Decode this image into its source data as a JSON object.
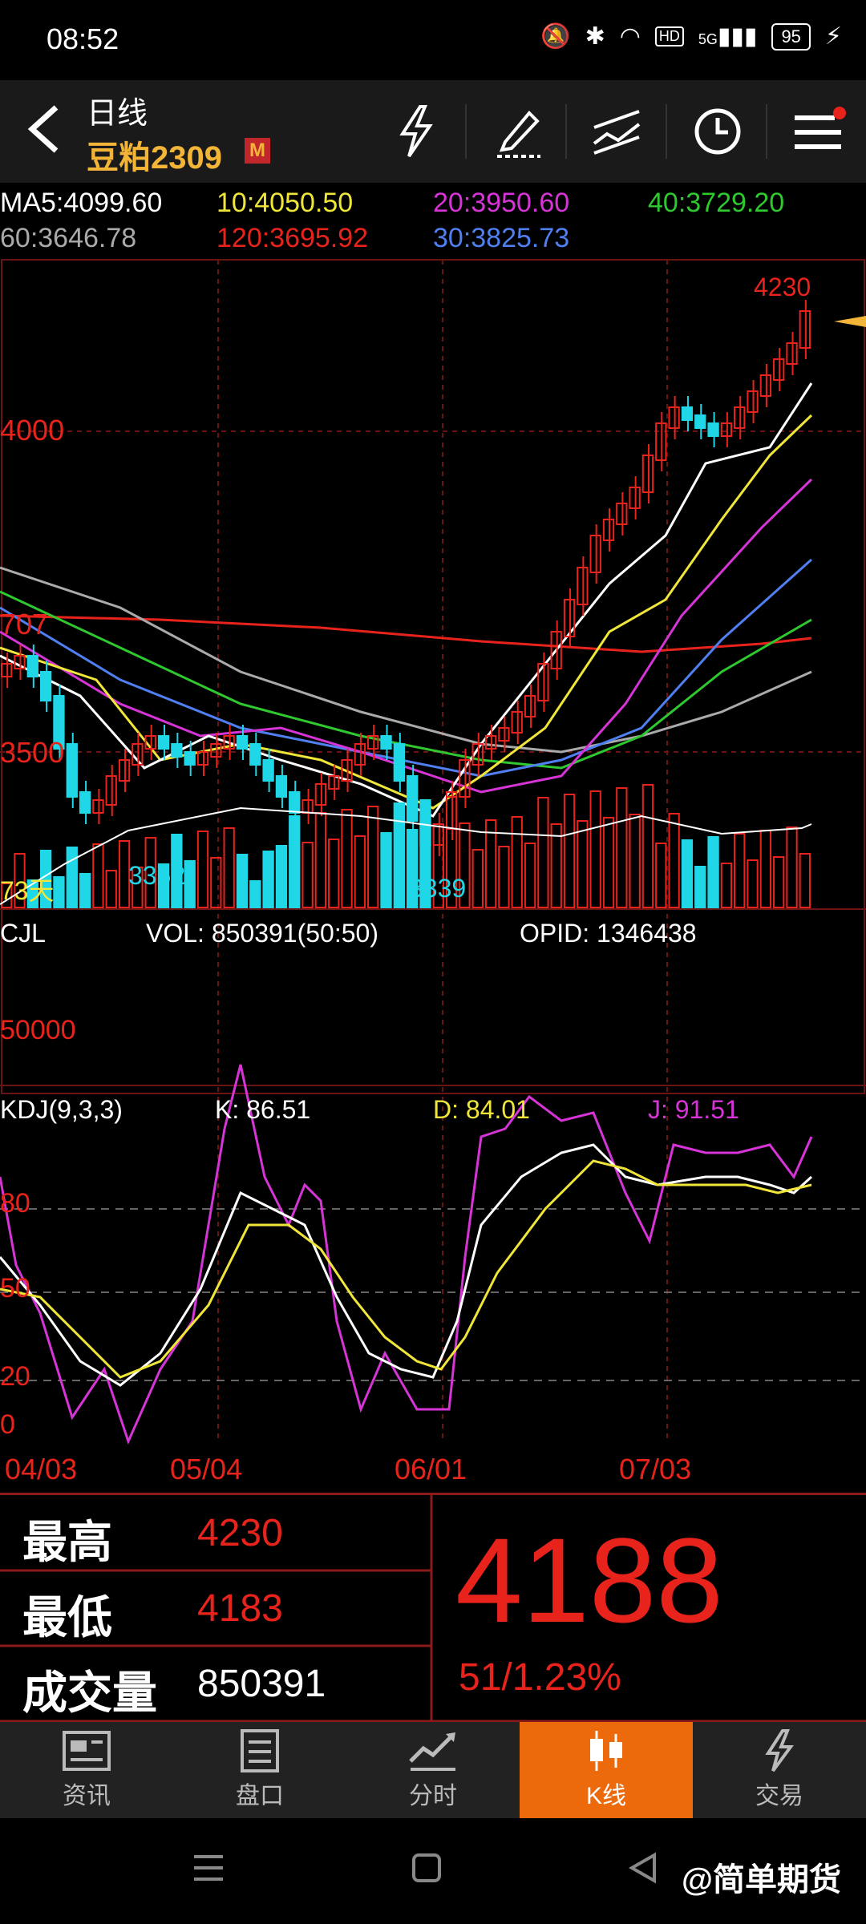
{
  "status": {
    "time": "08:52",
    "battery": "95",
    "net": "5G",
    "hd": "HD"
  },
  "header": {
    "title": "日线",
    "contract": "豆粕2309",
    "badge": "M"
  },
  "ma": {
    "ma5": "MA5:4099.60",
    "ma10": "10:4050.50",
    "ma20": "20:3950.60",
    "ma40": "40:3729.20",
    "ma60": "60:3646.78",
    "ma120": "120:3695.92",
    "ma30": "30:3825.73"
  },
  "chart": {
    "y_labels": [
      "4000",
      "3500",
      "707"
    ],
    "high_label": "4230",
    "low_label_1": "3362",
    "low_label_2": "3339",
    "days_label": "73天",
    "x_labels": [
      "04/03",
      "05/04",
      "06/01",
      "07/03"
    ]
  },
  "volume": {
    "name": "CJL",
    "vol": "VOL: 850391(50:50)",
    "opid": "OPID: 1346438",
    "ylabel": "50000"
  },
  "kdj": {
    "name": "KDJ(9,3,3)",
    "k": "K: 86.51",
    "d": "D: 84.01",
    "j": "J: 91.51",
    "levels": [
      "80",
      "50",
      "20",
      "0"
    ]
  },
  "info": {
    "high_label": "最高",
    "high": "4230",
    "low_label": "最低",
    "low": "4183",
    "vol_label": "成交量",
    "vol": "850391",
    "last": "4188",
    "change": "51/1.23%"
  },
  "tabs": [
    {
      "label": "资讯",
      "icon": "news-icon"
    },
    {
      "label": "盘口",
      "icon": "orderbook-icon"
    },
    {
      "label": "分时",
      "icon": "intraday-icon"
    },
    {
      "label": "K线",
      "icon": "kline-icon"
    },
    {
      "label": "交易",
      "icon": "trade-icon"
    }
  ],
  "watermark": "@简单期货",
  "colors": {
    "up": "#e8231c",
    "down": "#1fd7e6",
    "accent": "#f2b538",
    "tab_active": "#ec6a0c"
  }
}
